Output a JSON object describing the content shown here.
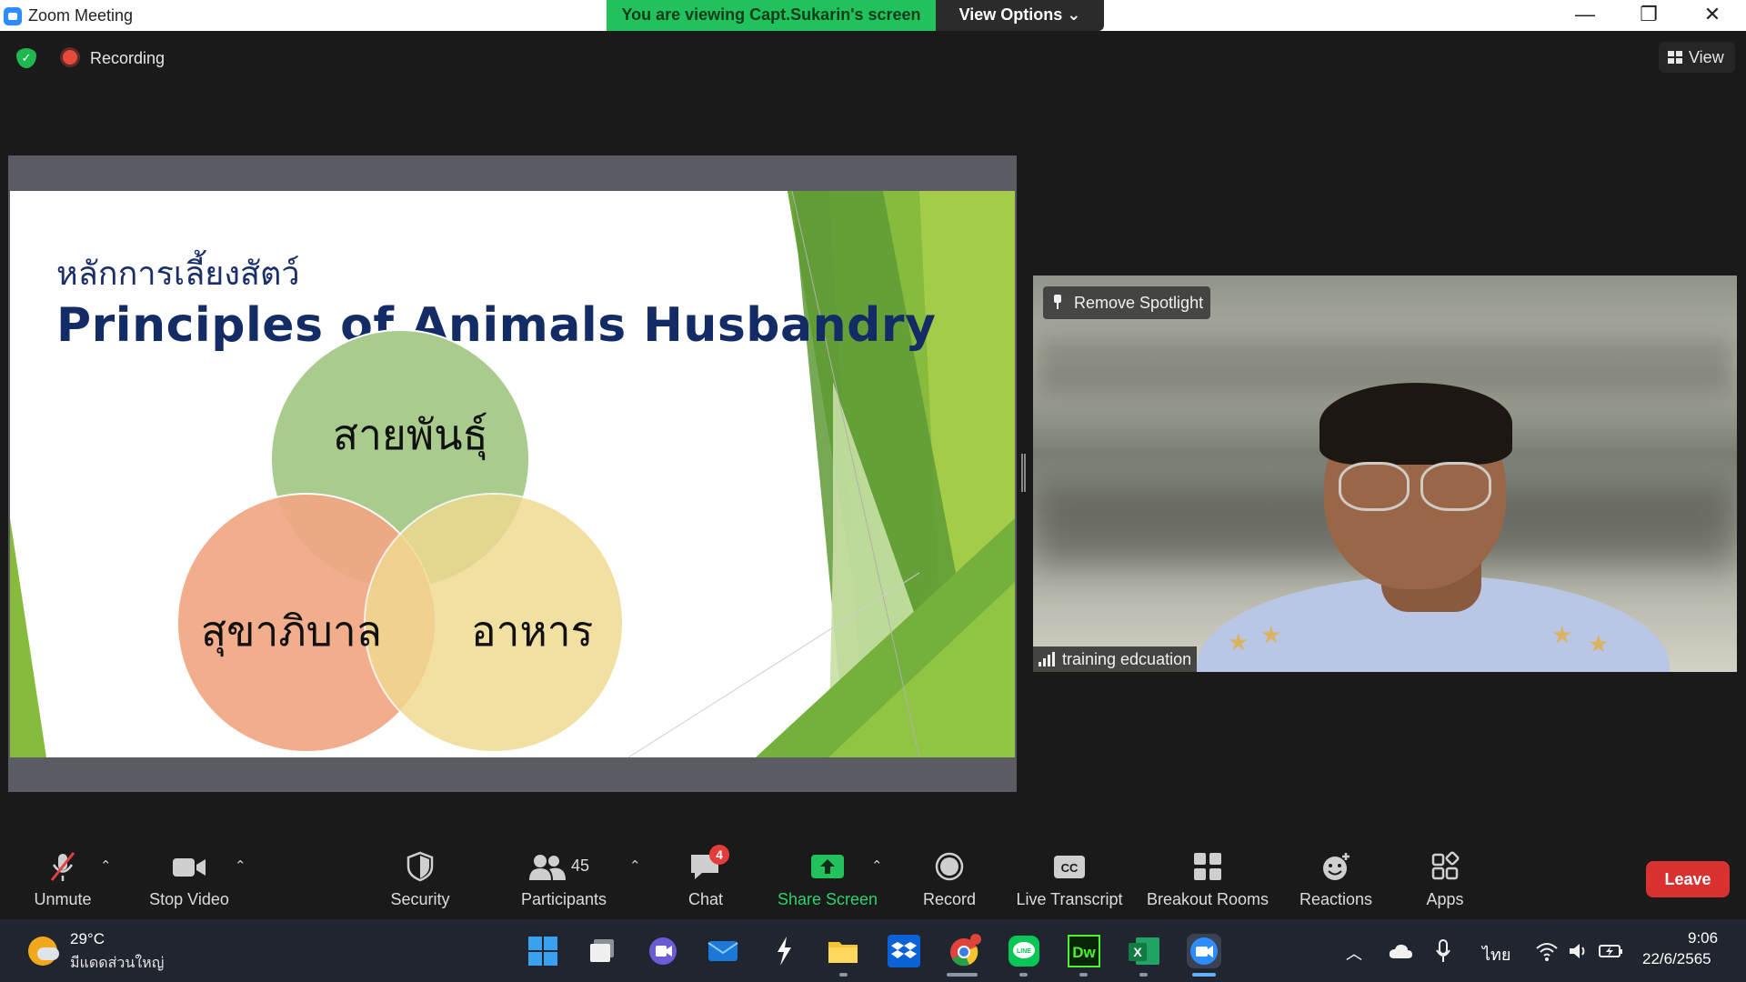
{
  "window": {
    "title": "Zoom Meeting",
    "minimize": "—",
    "restore": "❐",
    "close": "✕"
  },
  "banner": {
    "viewing_text": "You are viewing Capt.Sukarin's screen",
    "view_options_label": "View Options ⌄"
  },
  "header": {
    "shield_glyph": "✓",
    "recording_label": "Recording",
    "view_label": "View"
  },
  "slide": {
    "thai_title": "หลักการเลี้ยงสัตว์",
    "title": "Principles of Animals Husbandry",
    "venn": [
      "สายพันธุ์",
      "สุขาภิบาล",
      "อาหาร"
    ],
    "venn_colors": {
      "top": "#a9cc8e",
      "left": "#f0a784",
      "right": "#f0d98e"
    }
  },
  "video": {
    "spotlight_label": "Remove Spotlight",
    "participant_name": "training edcuation"
  },
  "toolbar": {
    "unmute": "Unmute",
    "stop_video": "Stop Video",
    "security": "Security",
    "participants": "Participants",
    "participants_count": "45",
    "chat": "Chat",
    "chat_badge": "4",
    "share_screen": "Share Screen",
    "record": "Record",
    "live_transcript": "Live Transcript",
    "cc_glyph": "CC",
    "breakout_rooms": "Breakout Rooms",
    "reactions": "Reactions",
    "apps": "Apps",
    "leave": "Leave",
    "caret": "⌃"
  },
  "taskbar": {
    "temperature": "29°C",
    "weather": "มีแดดส่วนใหญ่",
    "language": "ไทย",
    "time": "9:06",
    "date": "22/6/2565",
    "dw_label": "Dw",
    "excel_label": "X",
    "up_arrow": "︿"
  },
  "colors": {
    "share_green": "#21c15c",
    "leave_red": "#d93030",
    "zoom_blue": "#2d8cff"
  }
}
